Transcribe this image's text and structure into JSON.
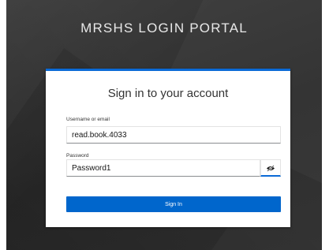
{
  "portal": {
    "title": "MRSHS LOGIN PORTAL"
  },
  "card": {
    "heading": "Sign in to your account",
    "username_label": "Username or email",
    "username_value": "read.book.4033",
    "password_label": "Password",
    "password_value": "Password1",
    "toggle_icon": "eye-slash-icon",
    "signin_label": "Sign In"
  },
  "colors": {
    "accent": "#0066cc",
    "background": "#333333"
  }
}
